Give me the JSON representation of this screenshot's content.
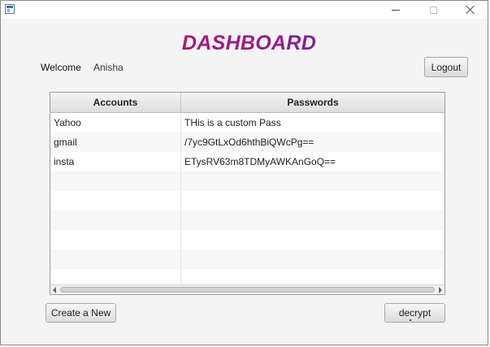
{
  "window": {
    "controls": {
      "minimize_icon": "minimize-icon",
      "maximize_icon": "maximize-icon",
      "close_icon": "close-icon"
    }
  },
  "header": {
    "title": "DASHBOARD",
    "welcome_label": "Welcome",
    "username": "Anisha",
    "logout_label": "Logout"
  },
  "table": {
    "columns": [
      "Accounts",
      "Passwords"
    ],
    "rows": [
      {
        "account": "Yahoo",
        "password": "THis is a custom Pass"
      },
      {
        "account": "gmail",
        "password": "/7yc9GtLxOd6hthBiQWcPg=="
      },
      {
        "account": "insta",
        "password": "ETysRV63m8TDMyAWKAnGoQ=="
      }
    ],
    "empty_rows": 6
  },
  "footer": {
    "create_label": "Create a New",
    "decrypt_label": "decrypt"
  },
  "colors": {
    "title_gradient_start": "#e0102a",
    "title_gradient_end": "#4a2ab0",
    "window_bg": "#f4f4f4"
  }
}
